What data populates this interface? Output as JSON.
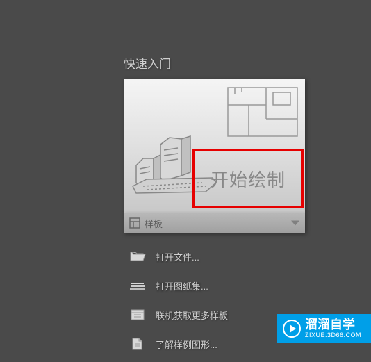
{
  "quickStart": {
    "title": "快速入门",
    "startDrawLabel": "开始绘制"
  },
  "template": {
    "label": "样板"
  },
  "menu": {
    "items": [
      {
        "label": "打开文件...",
        "icon": "folder-open"
      },
      {
        "label": "打开图纸集...",
        "icon": "sheets"
      },
      {
        "label": "联机获取更多样板",
        "icon": "download-template"
      },
      {
        "label": "了解样例图形...",
        "icon": "document-plus"
      }
    ]
  },
  "watermark": {
    "main": "溜溜自学",
    "sub": "ZIXUE.3D66.COM"
  }
}
